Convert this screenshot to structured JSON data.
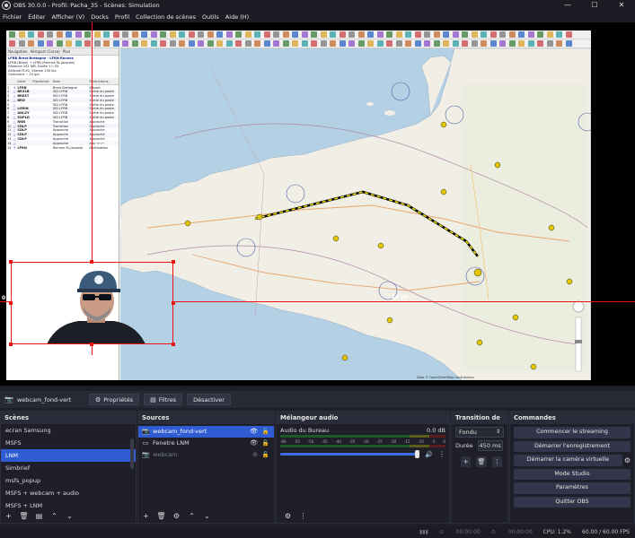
{
  "window": {
    "title": "OBS 30.0.0 - Profil: Pacha_35 - Scènes: Simulation",
    "controls": [
      "—",
      "☐",
      "✕"
    ]
  },
  "menu": [
    "Fichier",
    "Éditer",
    "Afficher (V)",
    "Docks",
    "Profil",
    "Collection de scènes",
    "Outils",
    "Aide (H)"
  ],
  "preview": {
    "lnm_tabs": [
      "Navigation",
      "Aéroport (Corse)",
      "Plan"
    ],
    "lnm_route_header": "LFRB Brest Bretagne - LFRN Rennes",
    "lnm_info": [
      "LFRB (Brest) → LFRN (Rennes St-Jacques)",
      "Distance 241 NM, Durée 1 h 35",
      "Altitude FL90, Vitesse 130 kts",
      "Carburant ~ 24 gal"
    ],
    "lnm_columns": [
      "",
      "",
      "Ident",
      "Procédure",
      "Nom",
      "Restrictions"
    ],
    "lnm_rows": [
      [
        "1",
        "✈",
        "LFRB",
        "",
        "Brest Bretagne",
        "Départ"
      ],
      [
        "2",
        "△",
        "BR31B",
        "",
        "SID LFRB",
        "Sortie du poste"
      ],
      [
        "3",
        "△",
        "BREST",
        "",
        "SID LFRB",
        "Sortie du poste"
      ],
      [
        "4",
        "△",
        "BRD",
        "",
        "SID LFRB",
        "Sortie du poste"
      ],
      [
        "5",
        "△",
        "",
        "",
        "SID LFRB",
        "Sortie du poste"
      ],
      [
        "6",
        "△",
        "LORIN",
        "",
        "SID LFRB",
        "Sortie du poste"
      ],
      [
        "7",
        "△",
        "ANLZY",
        "",
        "SID LFRB",
        "Sortie du poste"
      ],
      [
        "8",
        "△",
        "SOPLO",
        "",
        "SID LFRB",
        "Sortie du poste"
      ],
      [
        "9",
        "△",
        "RNN",
        "",
        "Transition",
        "Approche"
      ],
      [
        "10",
        "△",
        "CDLP",
        "",
        "Transition",
        "Approche"
      ],
      [
        "11",
        "△",
        "CDLP",
        "",
        "Approche",
        "Approche"
      ],
      [
        "12",
        "△",
        "CDLP",
        "",
        "Approche",
        "Approche"
      ],
      [
        "13",
        "△",
        "CDLP",
        "",
        "Approche",
        "Approche"
      ],
      [
        "14",
        "△",
        "",
        "",
        "Approche",
        "Approche"
      ],
      [
        "15",
        "✈",
        "LFRN",
        "",
        "Rennes St-Jacques",
        "Destination"
      ]
    ],
    "px_labels": [
      "155 px",
      "155 px",
      "0 px",
      "10 px"
    ],
    "map_attribution": "Data © OpenStreetMap contributors"
  },
  "source_toolbar": {
    "selected_source": "webcam_fond-vert",
    "properties_label": "Propriétés",
    "filters_label": "Filtres",
    "deactivate_label": "Désactiver"
  },
  "scenes": {
    "title": "Scènes",
    "items": [
      "ecran Samsung",
      "MSFS",
      "LNM",
      "Simbrief",
      "msfs_popup",
      "MSFS + webcam + audio",
      "MSFS + LNM"
    ],
    "selected": "LNM"
  },
  "sources": {
    "title": "Sources",
    "items": [
      {
        "name": "webcam_fond-vert",
        "icon": "camera-icon",
        "visible": true
      },
      {
        "name": "Fenetre LNM",
        "icon": "window-icon",
        "visible": true
      },
      {
        "name": "webcam",
        "icon": "camera-icon",
        "visible": false
      }
    ]
  },
  "mixer": {
    "title": "Mélangeur audio",
    "channel": "Audio du Bureau",
    "level": "0.0 dB",
    "scale": [
      "-60",
      "-55",
      "-50",
      "-45",
      "-40",
      "-35",
      "-30",
      "-25",
      "-20",
      "-15",
      "-10",
      "-5",
      "0"
    ]
  },
  "transitions": {
    "title": "Transition de s...",
    "type": "Fondu",
    "duration_label": "Durée",
    "duration": "450 ms"
  },
  "commands": {
    "title": "Commandes",
    "buttons": [
      "Commencer le streaming",
      "Démarrer l'enregistrement",
      "Démarrer la caméra virtuelle",
      "Mode Studio",
      "Paramètres",
      "Quitter OBS"
    ]
  },
  "status": {
    "stream_time": "00:00:00",
    "rec_time": "00:00:00",
    "cpu": "CPU: 1.2%",
    "fps": "60.00 / 60.00 FPS"
  },
  "colors": {
    "accent": "#2f5bd3",
    "selection": "#ee1111",
    "background": "#1e1f29"
  }
}
